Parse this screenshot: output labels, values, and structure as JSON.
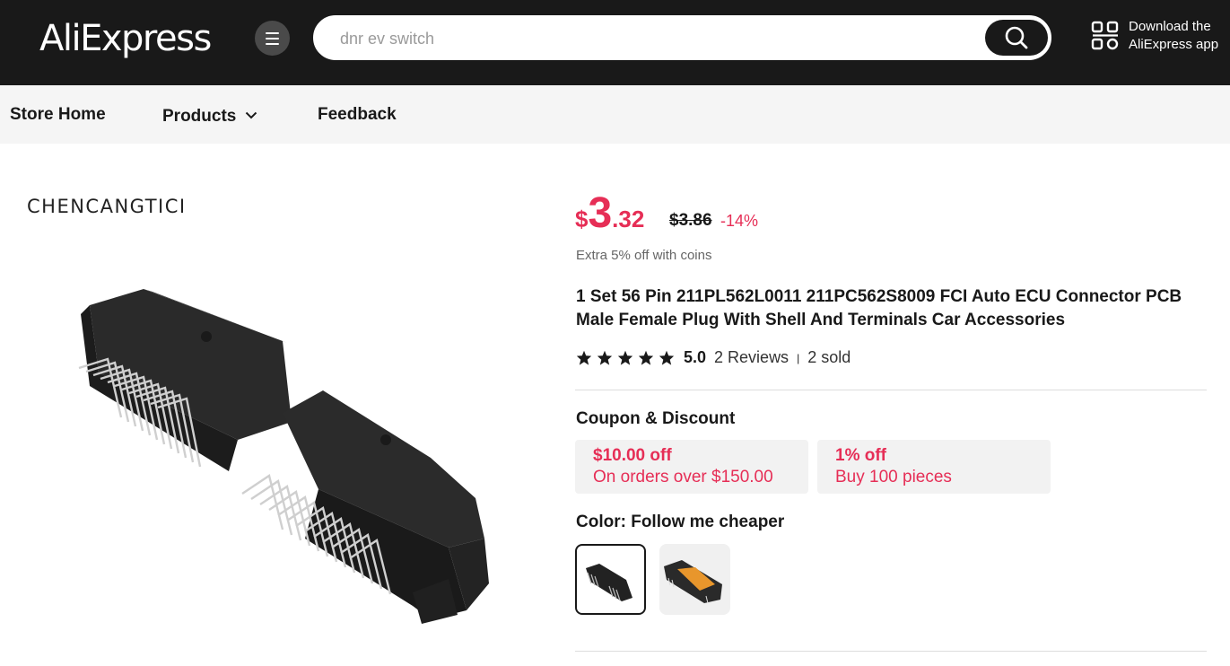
{
  "header": {
    "logo": "AliExpress",
    "search_placeholder": "dnr ev switch",
    "app_line1": "Download the",
    "app_line2": "AliExpress app"
  },
  "store_nav": {
    "home": "Store Home",
    "products": "Products",
    "feedback": "Feedback"
  },
  "product": {
    "brand": "CHENCANGTICI",
    "price_currency": "$",
    "price_int": "3",
    "price_dec": ".32",
    "original_price": "$3.86",
    "discount": "-14%",
    "coins_note": "Extra 5% off with coins",
    "title": "1 Set 56 Pin 211PL562L0011 211PC562S8009 FCI Auto ECU Connector PCB Male Female Plug With Shell And Terminals Car Accessories",
    "rating": "5.0",
    "reviews": "2 Reviews",
    "sold": "2 sold",
    "stars": 5
  },
  "coupons": {
    "heading": "Coupon & Discount",
    "items": [
      {
        "title": "$10.00 off",
        "desc": "On orders over $150.00"
      },
      {
        "title": "1% off",
        "desc": "Buy 100 pieces"
      }
    ]
  },
  "color": {
    "heading": "Color: Follow me cheaper"
  },
  "colors": {
    "accent": "#e62e56",
    "header_bg": "#191919",
    "nav_bg": "#f5f5f5"
  }
}
